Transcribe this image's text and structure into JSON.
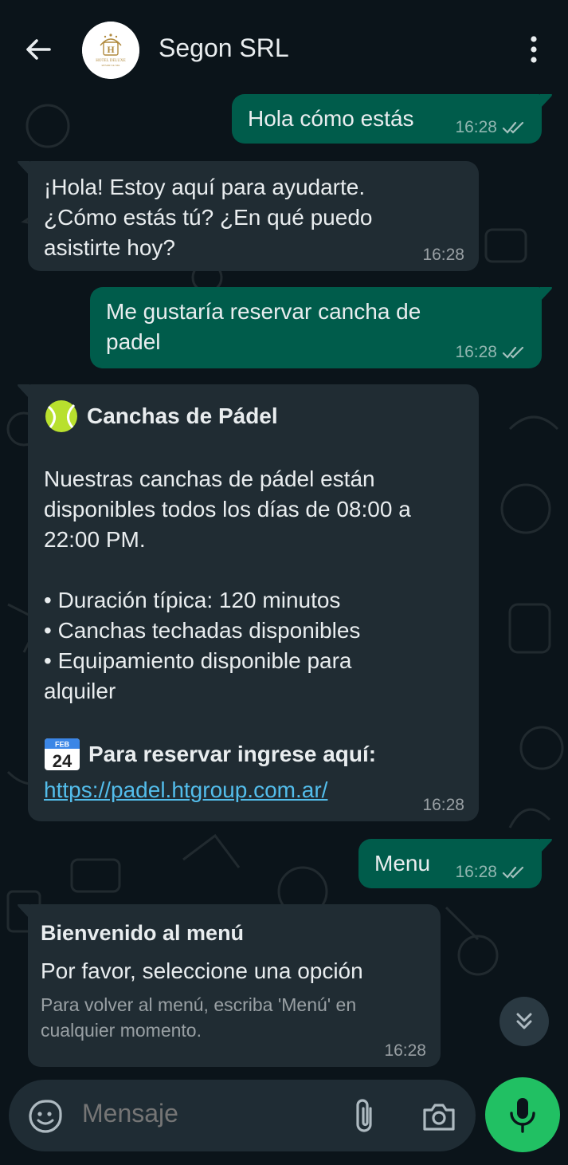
{
  "header": {
    "contact_name": "Segon SRL",
    "avatar_text": "HOTEL DELUXE",
    "avatar_subtext": "RESORT & SPA"
  },
  "messages": [
    {
      "direction": "outgoing",
      "text": "Hola cómo estás",
      "time": "16:28",
      "status": "read"
    },
    {
      "direction": "incoming",
      "lines": [
        "¡Hola! Estoy aquí para ayudarte.",
        "¿Cómo estás tú? ¿En qué puedo",
        "asistirte hoy?"
      ],
      "time": "16:28"
    },
    {
      "direction": "outgoing",
      "lines": [
        "Me gustaría reservar cancha de",
        "padel"
      ],
      "time": "16:28",
      "status": "read"
    },
    {
      "direction": "incoming",
      "title": "Canchas de Pádel",
      "title_icon": "tennis-ball-emoji",
      "paragraph_lines": [
        "Nuestras canchas de pádel están",
        "disponibles todos los días de 08:00 a",
        "22:00 PM."
      ],
      "bullets": [
        "• Duración típica: 120 minutos",
        "• Canchas techadas disponibles",
        "• Equipamiento disponible para",
        "alquiler"
      ],
      "reserve_label": "Para reservar ingrese aquí:",
      "reserve_icon": "calendar-emoji",
      "calendar_month": "FEB",
      "calendar_day": "24",
      "link": "https://padel.htgroup.com.ar/",
      "time": "16:28"
    },
    {
      "direction": "outgoing",
      "text": "Menu",
      "time": "16:28",
      "status": "read"
    },
    {
      "direction": "incoming",
      "title": "Bienvenido al menú",
      "body": "Por favor, seleccione una opción",
      "footer_lines": [
        "Para volver al menú, escriba 'Menú' en",
        "cualquier momento."
      ],
      "time": "16:28"
    }
  ],
  "input": {
    "placeholder": "Mensaje"
  },
  "colors": {
    "background": "#0b141a",
    "outgoing_bubble": "#005c4b",
    "incoming_bubble": "#202c33",
    "link": "#53bdeb",
    "mic_button": "#21c063"
  },
  "icons": [
    "back-arrow-icon",
    "more-vertical-icon",
    "double-check-icon",
    "chevron-double-down-icon",
    "sticker-icon",
    "paperclip-icon",
    "camera-icon",
    "microphone-icon"
  ]
}
